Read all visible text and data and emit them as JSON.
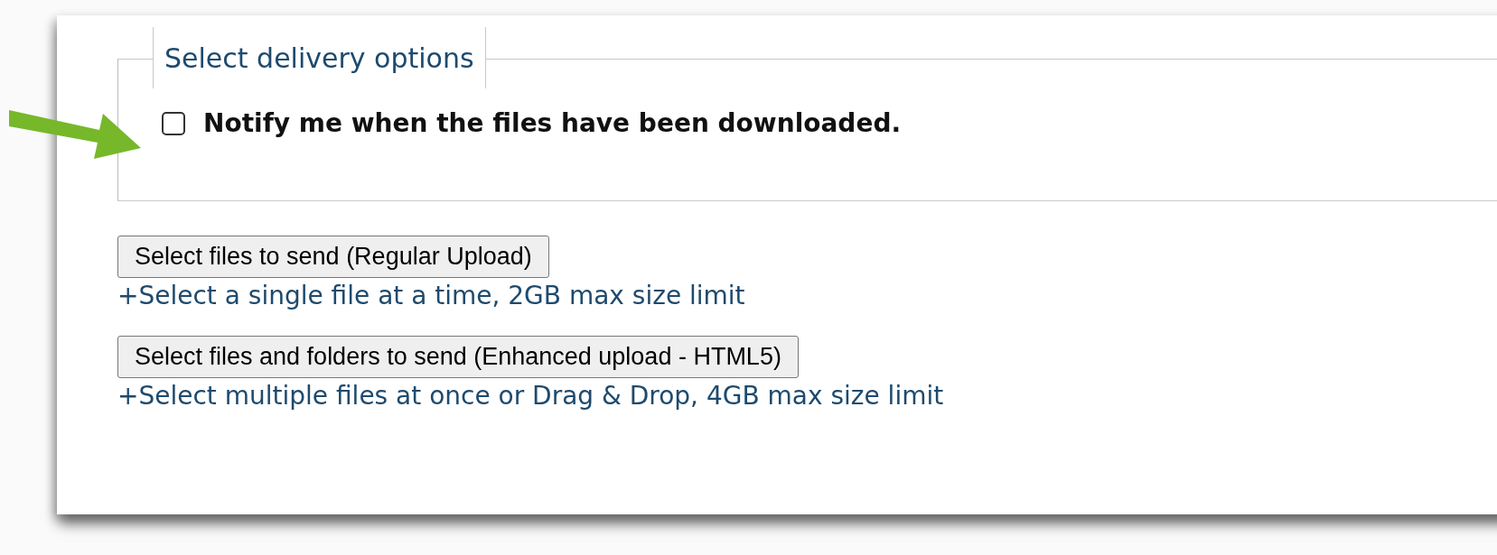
{
  "delivery_options": {
    "legend": "Select delivery options",
    "notify_checkbox": {
      "label": "Notify me when the files have been downloaded.",
      "checked": false
    }
  },
  "uploads": [
    {
      "button": "Select files to send (Regular Upload)",
      "hint": "+Select a single file at a time, 2GB max size limit"
    },
    {
      "button": "Select files and folders to send (Enhanced upload - HTML5)",
      "hint": "+Select multiple files at once or Drag & Drop, 4GB max size limit"
    }
  ]
}
